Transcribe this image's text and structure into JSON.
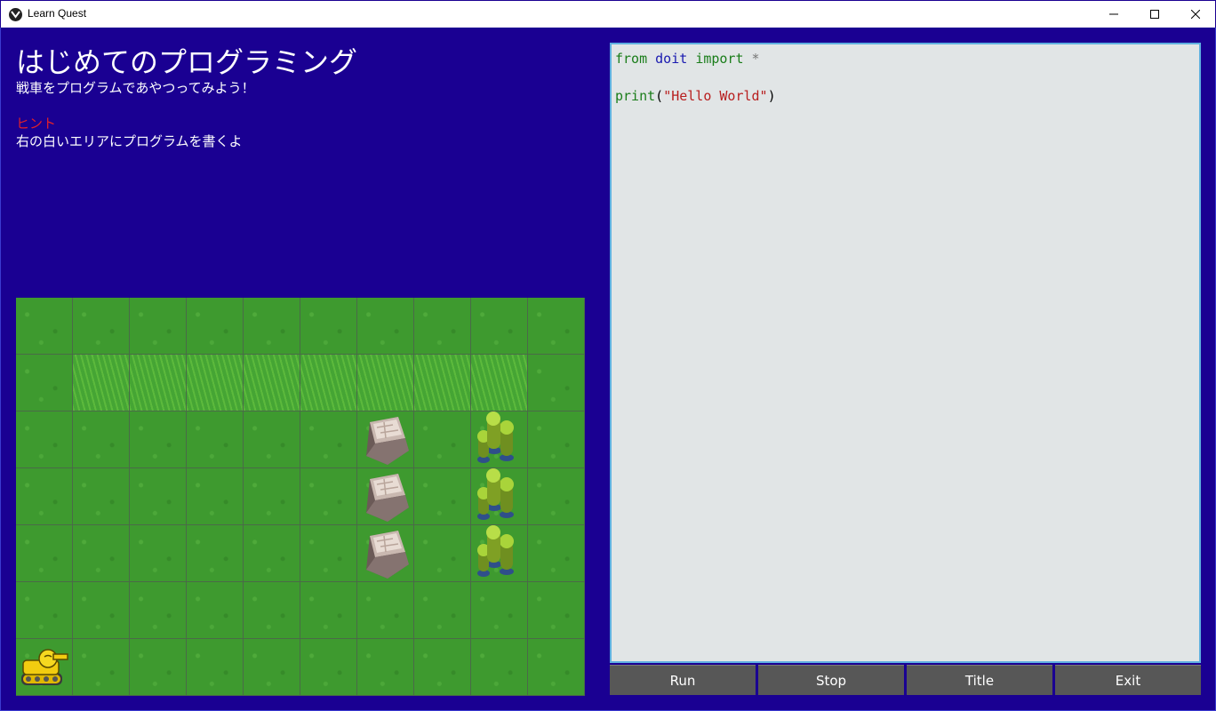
{
  "window": {
    "title": "Learn Quest"
  },
  "lesson": {
    "title": "はじめてのプログラミング",
    "subtitle": "戦車をプログラムであやつってみよう！",
    "hint_label": "ヒント",
    "hint_text": "右の白いエリアにプログラムを書くよ"
  },
  "board": {
    "columns": 10,
    "rows": 7,
    "tall_grass_row": 1,
    "objects": [
      {
        "type": "rock",
        "col": 6,
        "row": 2
      },
      {
        "type": "rock",
        "col": 6,
        "row": 3
      },
      {
        "type": "rock",
        "col": 6,
        "row": 4
      },
      {
        "type": "trees",
        "col": 8,
        "row": 2
      },
      {
        "type": "trees",
        "col": 8,
        "row": 3
      },
      {
        "type": "trees",
        "col": 8,
        "row": 4
      },
      {
        "type": "tank",
        "col": 0,
        "row": 6
      }
    ]
  },
  "editor": {
    "line1": {
      "from": "from",
      "module": "doit",
      "import": "import",
      "star": "*"
    },
    "line3": {
      "func": "print",
      "open": "(",
      "string": "\"Hello World\"",
      "close": ")"
    }
  },
  "buttons": {
    "run": "Run",
    "stop": "Stop",
    "title": "Title",
    "exit": "Exit"
  },
  "colors": {
    "background": "#1a0092",
    "hint": "#e0202a",
    "editor_bg": "#e1e5e6",
    "button_bg": "#575757"
  }
}
